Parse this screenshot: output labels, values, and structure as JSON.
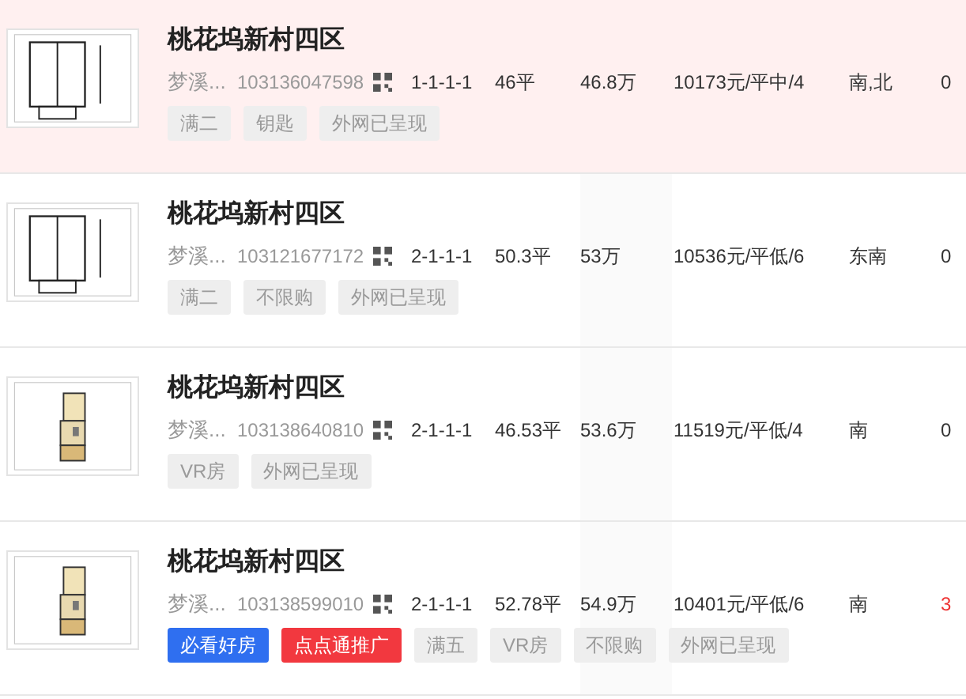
{
  "listings": [
    {
      "selected": true,
      "kind": "plain",
      "title": "桃花坞新村四区",
      "district": "梦溪...",
      "code": "103136047598",
      "layout": "1-1-1-1",
      "area": "46平",
      "price": "46.8万",
      "unit_price": "10173元/平中/4",
      "orientation": "南,北",
      "count": "0",
      "count_alert": false,
      "tags": [
        {
          "label": "满二",
          "kind": "plain"
        },
        {
          "label": "钥匙",
          "kind": "plain"
        },
        {
          "label": "外网已呈现",
          "kind": "plain"
        }
      ]
    },
    {
      "selected": false,
      "kind": "plain",
      "title": "桃花坞新村四区",
      "district": "梦溪...",
      "code": "103121677172",
      "layout": "2-1-1-1",
      "area": "50.3平",
      "price": "53万",
      "unit_price": "10536元/平低/6",
      "orientation": "东南",
      "count": "0",
      "count_alert": false,
      "tags": [
        {
          "label": "满二",
          "kind": "plain"
        },
        {
          "label": "不限购",
          "kind": "plain"
        },
        {
          "label": "外网已呈现",
          "kind": "plain"
        }
      ]
    },
    {
      "selected": false,
      "kind": "colored",
      "title": "桃花坞新村四区",
      "district": "梦溪...",
      "code": "103138640810",
      "layout": "2-1-1-1",
      "area": "46.53平",
      "price": "53.6万",
      "unit_price": "11519元/平低/4",
      "orientation": "南",
      "count": "0",
      "count_alert": false,
      "tags": [
        {
          "label": "VR房",
          "kind": "plain"
        },
        {
          "label": "外网已呈现",
          "kind": "plain"
        }
      ]
    },
    {
      "selected": false,
      "kind": "colored",
      "title": "桃花坞新村四区",
      "district": "梦溪...",
      "code": "103138599010",
      "layout": "2-1-1-1",
      "area": "52.78平",
      "price": "54.9万",
      "unit_price": "10401元/平低/6",
      "orientation": "南",
      "count": "3",
      "count_alert": true,
      "tags": [
        {
          "label": "必看好房",
          "kind": "blue"
        },
        {
          "label": "点点通推广",
          "kind": "red"
        },
        {
          "label": "满五",
          "kind": "plain"
        },
        {
          "label": "VR房",
          "kind": "plain"
        },
        {
          "label": "不限购",
          "kind": "plain"
        },
        {
          "label": "外网已呈现",
          "kind": "plain"
        }
      ]
    }
  ]
}
